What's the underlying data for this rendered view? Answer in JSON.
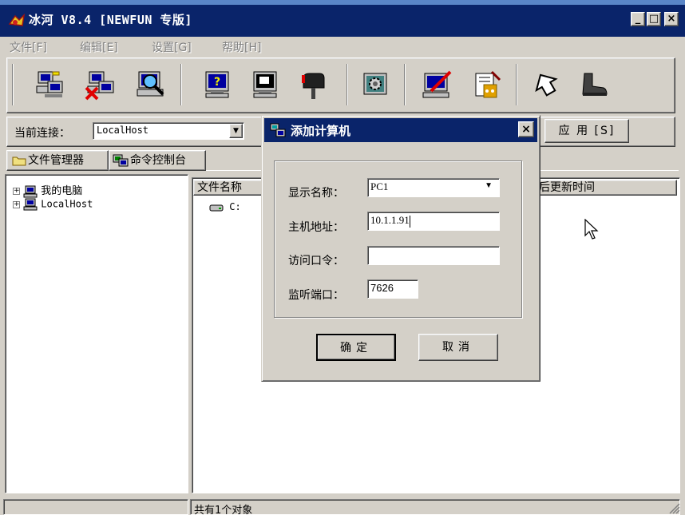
{
  "window": {
    "title": "冰河 V8.4 [NEWFUN 专版]",
    "minimize": "_",
    "maximize": "□",
    "close": "×"
  },
  "menu": [
    {
      "label": "文件[F]"
    },
    {
      "label": "编辑[E]"
    },
    {
      "label": "设置[G]"
    },
    {
      "label": "帮助[H]"
    }
  ],
  "toolbar": {
    "icons": [
      "add-host-icon",
      "remove-host-icon",
      "search-host-icon",
      "help-monitor-icon",
      "screen-icon",
      "mailbox-icon",
      "settings-gear-icon",
      "edit-monitor-icon",
      "config-tools-icon",
      "arrow-icon",
      "boot-icon"
    ]
  },
  "connection": {
    "label": "当前连接：",
    "value": "LocalHost",
    "apply_label": "应 用 [S]"
  },
  "tabs": [
    {
      "label": "文件管理器"
    },
    {
      "label": "命令控制台"
    }
  ],
  "tree": [
    {
      "label": "我的电脑"
    },
    {
      "label": "LocalHost"
    }
  ],
  "file_list": {
    "col_name": "文件名称",
    "col_time": "后更新时间",
    "rows": [
      {
        "name": "C:"
      }
    ]
  },
  "status": {
    "text": "共有1个对象"
  },
  "dialog": {
    "title": "添加计算机",
    "close": "×",
    "fields": {
      "display_name_label": "显示名称：",
      "display_name_value": "PC1",
      "host_label": "主机地址：",
      "host_value": "10.1.1.91",
      "password_label": "访问口令：",
      "password_value": "",
      "port_label": "监听端口：",
      "port_value": "7626"
    },
    "ok_label": "确定",
    "cancel_label": "取消"
  },
  "colors": {
    "titlebar": "#0a246a",
    "face": "#d4d0c8"
  }
}
